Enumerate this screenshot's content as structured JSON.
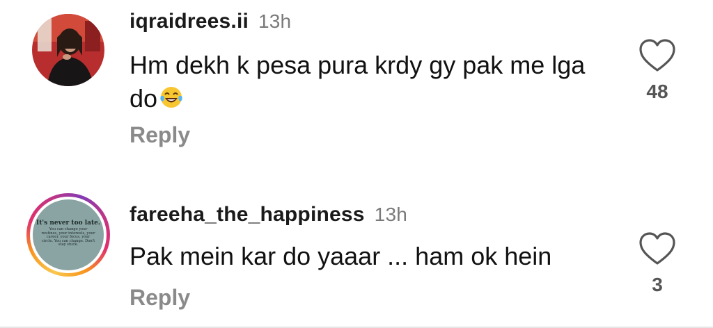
{
  "comments": [
    {
      "username": "iqraidrees.ii",
      "time": "13h",
      "text": "Hm dekh k pesa pura krdy gy pak me lga do",
      "emoji": "face-with-tears-of-joy",
      "reply_label": "Reply",
      "likes": "48"
    },
    {
      "username": "fareeha_the_happiness",
      "time": "13h",
      "text": "Pak mein kar do yaaar ... ham ok hein",
      "reply_label": "Reply",
      "likes": "3",
      "avatar": {
        "quote_title": "It's never too late.",
        "quote_body": "You can change your routines, your interests, your career, your focus, your circle. You can change. Don't stay stuck."
      }
    }
  ],
  "colors": {
    "username": "#1a1a1a",
    "timestamp": "#7a7a7a",
    "reply": "#8a8a8a",
    "like_count": "#555555",
    "story_ring": [
      "#f9c74f",
      "#e1306c",
      "#833ab4"
    ]
  }
}
